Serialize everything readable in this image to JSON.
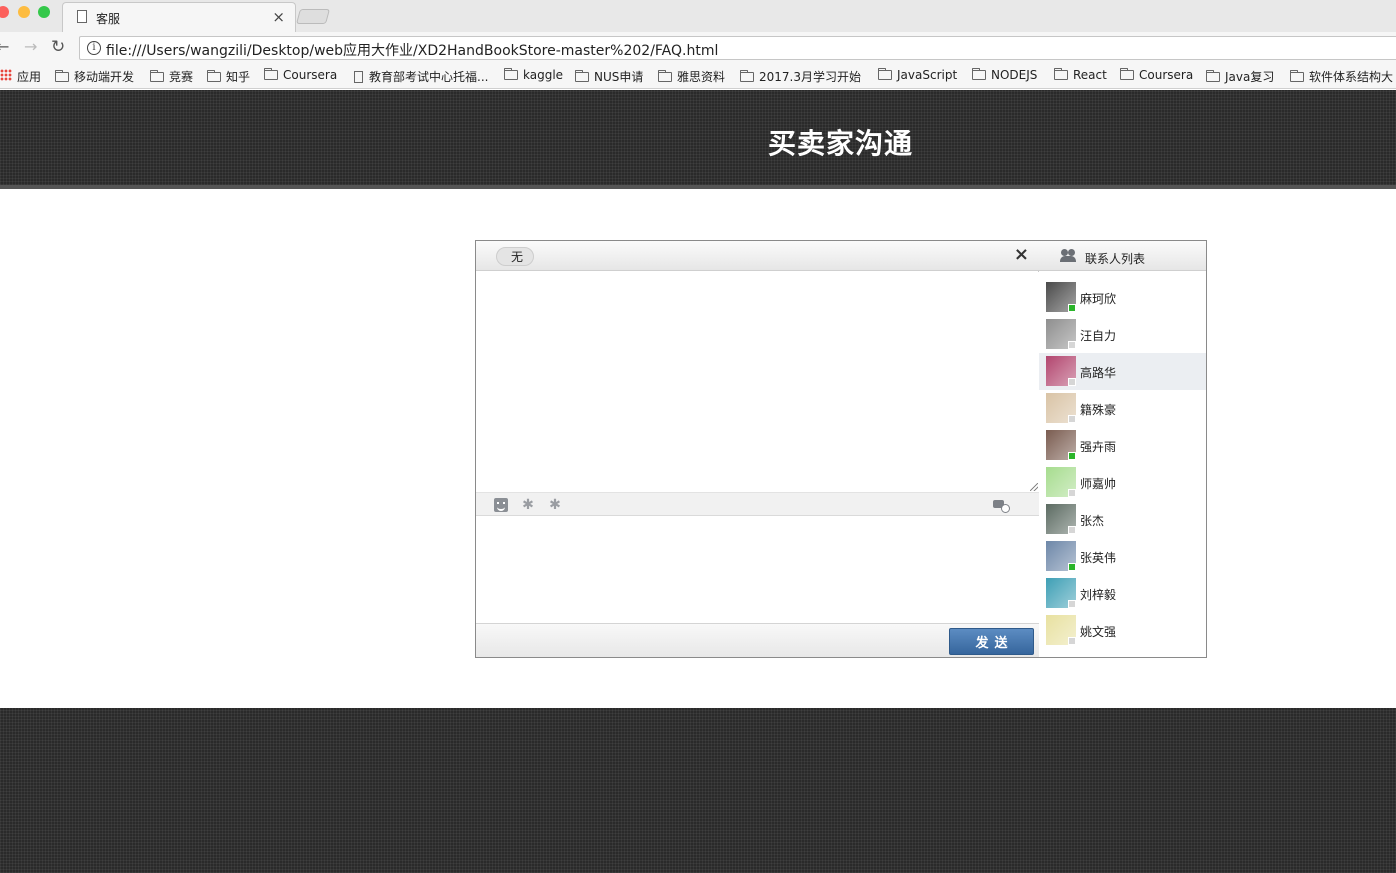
{
  "browser": {
    "tab_title": "客服",
    "url": "file:///Users/wangzili/Desktop/web应用大作业/XD2HandBookStore-master%202/FAQ.html",
    "bookmarks": [
      "应用",
      "移动端开发",
      "竞赛",
      "知乎",
      "Coursera",
      "教育部考试中心托福...",
      "kaggle",
      "NUS申请",
      "雅思资料",
      "2017.3月学习开始",
      "JavaScript",
      "NODEJS",
      "React",
      "Coursera",
      "Java复习",
      "软件体系结构大"
    ]
  },
  "page": {
    "title": "买卖家沟通"
  },
  "chat": {
    "target_name": "无",
    "close_label": "×",
    "message_input_value": "",
    "send_label": "发送",
    "contacts_title": "联系人列表",
    "contacts": [
      {
        "name": "麻珂欣",
        "status": "online",
        "avatar_color": "#4a4a4a",
        "selected": false
      },
      {
        "name": "汪自力",
        "status": "offline",
        "avatar_color": "#8e8e8e",
        "selected": false
      },
      {
        "name": "高路华",
        "status": "offline",
        "avatar_color": "#b2456e",
        "selected": true
      },
      {
        "name": "籍殊豪",
        "status": "offline",
        "avatar_color": "#d9c3a5",
        "selected": false
      },
      {
        "name": "强卉雨",
        "status": "online",
        "avatar_color": "#7a5c50",
        "selected": false
      },
      {
        "name": "师嘉帅",
        "status": "offline",
        "avatar_color": "#a6dc8e",
        "selected": false
      },
      {
        "name": "张杰",
        "status": "offline",
        "avatar_color": "#5c6b62",
        "selected": false
      },
      {
        "name": "张英伟",
        "status": "online",
        "avatar_color": "#6d87a8",
        "selected": false
      },
      {
        "name": "刘梓毅",
        "status": "offline",
        "avatar_color": "#3e9fb5",
        "selected": false
      },
      {
        "name": "姚文强",
        "status": "offline",
        "avatar_color": "#e8e1a0",
        "selected": false
      }
    ]
  }
}
